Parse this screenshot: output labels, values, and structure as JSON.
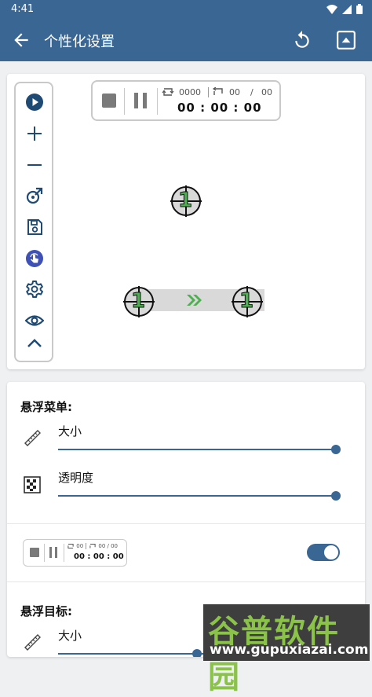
{
  "status_bar": {
    "time": "4:41"
  },
  "app_bar": {
    "title": "个性化设置"
  },
  "preview": {
    "control_bar": {
      "loop_count": "0000",
      "repeat_current": "00",
      "repeat_separator": "/",
      "repeat_total": "00",
      "timer": "00 : 00 : 00"
    },
    "target_label": "1",
    "side_menu_icons": [
      "play-icon",
      "plus-icon",
      "minus-icon",
      "swipe-icon",
      "save-icon",
      "touch-icon",
      "settings-icon",
      "eye-icon",
      "chevron-up-icon"
    ]
  },
  "settings": {
    "floating_menu": {
      "title": "悬浮菜单:",
      "size_label": "大小",
      "size_value": 1.0,
      "opacity_label": "透明度",
      "opacity_value": 1.0
    },
    "mini_bar": {
      "loop_count": "00",
      "repeat": "00 / 00",
      "timer": "00 : 00 : 00",
      "toggle_on": true
    },
    "floating_target": {
      "title": "悬浮目标:",
      "size_label": "大小",
      "size_value": 0.5
    }
  },
  "watermark": {
    "brand": "谷普软件园",
    "url": "www.gupuxiazai.com"
  },
  "colors": {
    "primary": "#3a6694",
    "accent_blue": "#3f51b5",
    "arrow_green": "#4caf50"
  }
}
